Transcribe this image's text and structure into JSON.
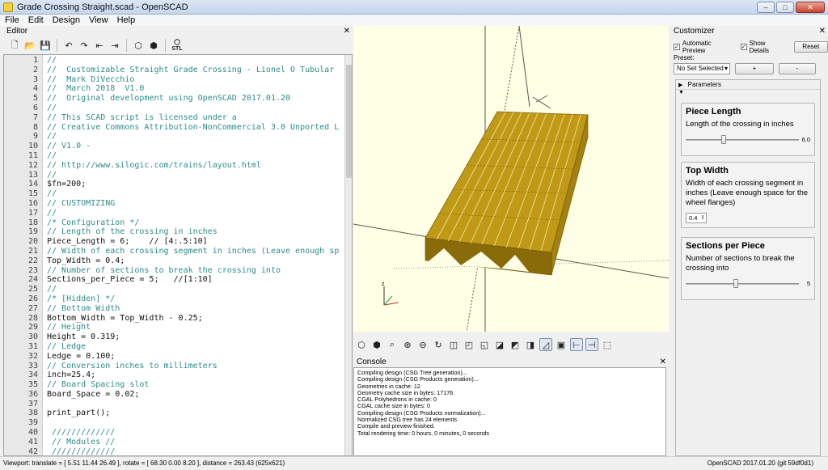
{
  "window": {
    "title": "Grade Crossing Straight.scad - OpenSCAD",
    "minimize": "–",
    "maximize": "□",
    "close": "✕"
  },
  "menu": [
    "File",
    "Edit",
    "Design",
    "View",
    "Help"
  ],
  "editor": {
    "title": "Editor",
    "close": "✕",
    "toolbar_icons": [
      "new-file-icon",
      "open-file-icon",
      "save-icon",
      "undo-icon",
      "redo-icon",
      "unindent-icon",
      "indent-icon",
      "preview-icon",
      "render-icon",
      "export-stl-icon"
    ],
    "stl_label": "STL",
    "lines": [
      {
        "n": "1",
        "t": "//",
        "cls": "c"
      },
      {
        "n": "2",
        "t": "//  Customizable Straight Grade Crossing - Lionel O Tubular",
        "cls": "c"
      },
      {
        "n": "3",
        "t": "//  Mark DiVecchio",
        "cls": "c"
      },
      {
        "n": "4",
        "t": "//  March 2018  V1.0",
        "cls": "c"
      },
      {
        "n": "5",
        "t": "//  Original development using OpenSCAD 2017.01.20",
        "cls": "c"
      },
      {
        "n": "6",
        "t": "//",
        "cls": "c"
      },
      {
        "n": "7",
        "t": "// This SCAD script is licensed under a",
        "cls": "c"
      },
      {
        "n": "8",
        "t": "// Creative Commons Attribution-NonCommercial 3.0 Unported L",
        "cls": "c"
      },
      {
        "n": "9",
        "t": "//",
        "cls": "c"
      },
      {
        "n": "10",
        "t": "// V1.0 -",
        "cls": "c"
      },
      {
        "n": "11",
        "t": "//",
        "cls": "c"
      },
      {
        "n": "12",
        "t": "// http://www.silogic.com/trains/layout.html",
        "cls": "c"
      },
      {
        "n": "13",
        "t": "//",
        "cls": "c"
      },
      {
        "n": "14",
        "t": "$fn=200;",
        "cls": "k"
      },
      {
        "n": "15",
        "t": "//",
        "cls": "c"
      },
      {
        "n": "16",
        "t": "// CUSTOMIZING",
        "cls": "c"
      },
      {
        "n": "17",
        "t": "//",
        "cls": "c"
      },
      {
        "n": "18",
        "t": "/* Configuration */",
        "cls": "c"
      },
      {
        "n": "19",
        "t": "// Length of the crossing in inches",
        "cls": "c"
      },
      {
        "n": "20",
        "t": "Piece_Length = 6;    // [4:.5:10]",
        "cls": "k"
      },
      {
        "n": "21",
        "t": "// Width of each crossing segment in inches (Leave enough sp",
        "cls": "c"
      },
      {
        "n": "22",
        "t": "Top_Width = 0.4;",
        "cls": "k"
      },
      {
        "n": "23",
        "t": "// Number of sections to break the crossing into",
        "cls": "c"
      },
      {
        "n": "24",
        "t": "Sections_per_Piece = 5;   //[1:10]",
        "cls": "k"
      },
      {
        "n": "25",
        "t": "//",
        "cls": "c"
      },
      {
        "n": "26",
        "t": "/* [Hidden] */",
        "cls": "c"
      },
      {
        "n": "27",
        "t": "// Bottom Width",
        "cls": "c"
      },
      {
        "n": "28",
        "t": "Bottom_Width = Top_Width - 0.25;",
        "cls": "k"
      },
      {
        "n": "29",
        "t": "// Height",
        "cls": "c"
      },
      {
        "n": "30",
        "t": "Height = 0.319;",
        "cls": "k"
      },
      {
        "n": "31",
        "t": "// Ledge",
        "cls": "c"
      },
      {
        "n": "32",
        "t": "Ledge = 0.100;",
        "cls": "k"
      },
      {
        "n": "33",
        "t": "// Conversion inches to millimeters",
        "cls": "c"
      },
      {
        "n": "34",
        "t": "inch=25.4;",
        "cls": "k"
      },
      {
        "n": "35",
        "t": "// Board Spacing slot",
        "cls": "c"
      },
      {
        "n": "36",
        "t": "Board_Space = 0.02;",
        "cls": "k"
      },
      {
        "n": "37",
        "t": "",
        "cls": "k"
      },
      {
        "n": "38",
        "t": "print_part();",
        "cls": "k"
      },
      {
        "n": "39",
        "t": "",
        "cls": "k"
      },
      {
        "n": "40",
        "t": " /////////////",
        "cls": "c"
      },
      {
        "n": "41",
        "t": " // Modules //",
        "cls": "c"
      },
      {
        "n": "42",
        "t": " /////////////",
        "cls": "c"
      }
    ]
  },
  "viewport": {
    "axis_label": "z",
    "model_color": "#c09a17",
    "view_icons": [
      "preview-icon",
      "render-icon",
      "view-all-icon",
      "zoom-in-icon",
      "zoom-out-icon",
      "reset-view-icon",
      "view-right-icon",
      "view-top-icon",
      "view-bottom-icon",
      "view-left-icon",
      "view-front-icon",
      "view-back-icon",
      "perspective-icon",
      "orthogonal-icon",
      "show-axes-icon",
      "show-scale-icon",
      "show-edges-icon"
    ]
  },
  "console": {
    "title": "Console",
    "close": "✕",
    "lines": [
      "Compiling design (CSG Tree generation)...",
      "Compiling design (CSG Products generation)...",
      "Geometries in cache: 12",
      "Geometry cache size in bytes: 17176",
      "CGAL Polyhedrons in cache: 0",
      "CGAL cache size in bytes: 0",
      "Compiling design (CSG Products normalization)...",
      "Normalized CSG tree has 24 elements",
      "Compile and preview finished.",
      "Total rendering time: 0 hours, 0 minutes, 0 seconds"
    ]
  },
  "customizer": {
    "title": "Customizer",
    "close": "✕",
    "automatic_preview": "Automatic Preview",
    "show_details": "Show Details",
    "reset": "Reset",
    "preset_label": "Preset:",
    "preset_value": "No Set Selected",
    "add": "+",
    "remove": "-",
    "parameters_label": "Parameters",
    "groups": [
      {
        "title": "Piece Length",
        "desc": "Length of the crossing in inches",
        "value": "6.0",
        "min": 4,
        "max": 10,
        "current": 6.0
      },
      {
        "title": "Top Width",
        "desc": "Width of each crossing segment in inches (Leave enough space for the wheel flanges)",
        "value": "0.4"
      },
      {
        "title": "Sections per Piece",
        "desc": "Number of sections to break the crossing into",
        "value": "5",
        "min": 1,
        "max": 10,
        "current": 5
      }
    ]
  },
  "status": {
    "viewport": "Viewport: translate = [ 5.51 11.44 26.49 ], rotate = [ 68.30 0.00 8.20 ], distance = 263.43 (625x621)",
    "version": "OpenSCAD 2017.01.20 (git 59df0d1)"
  }
}
